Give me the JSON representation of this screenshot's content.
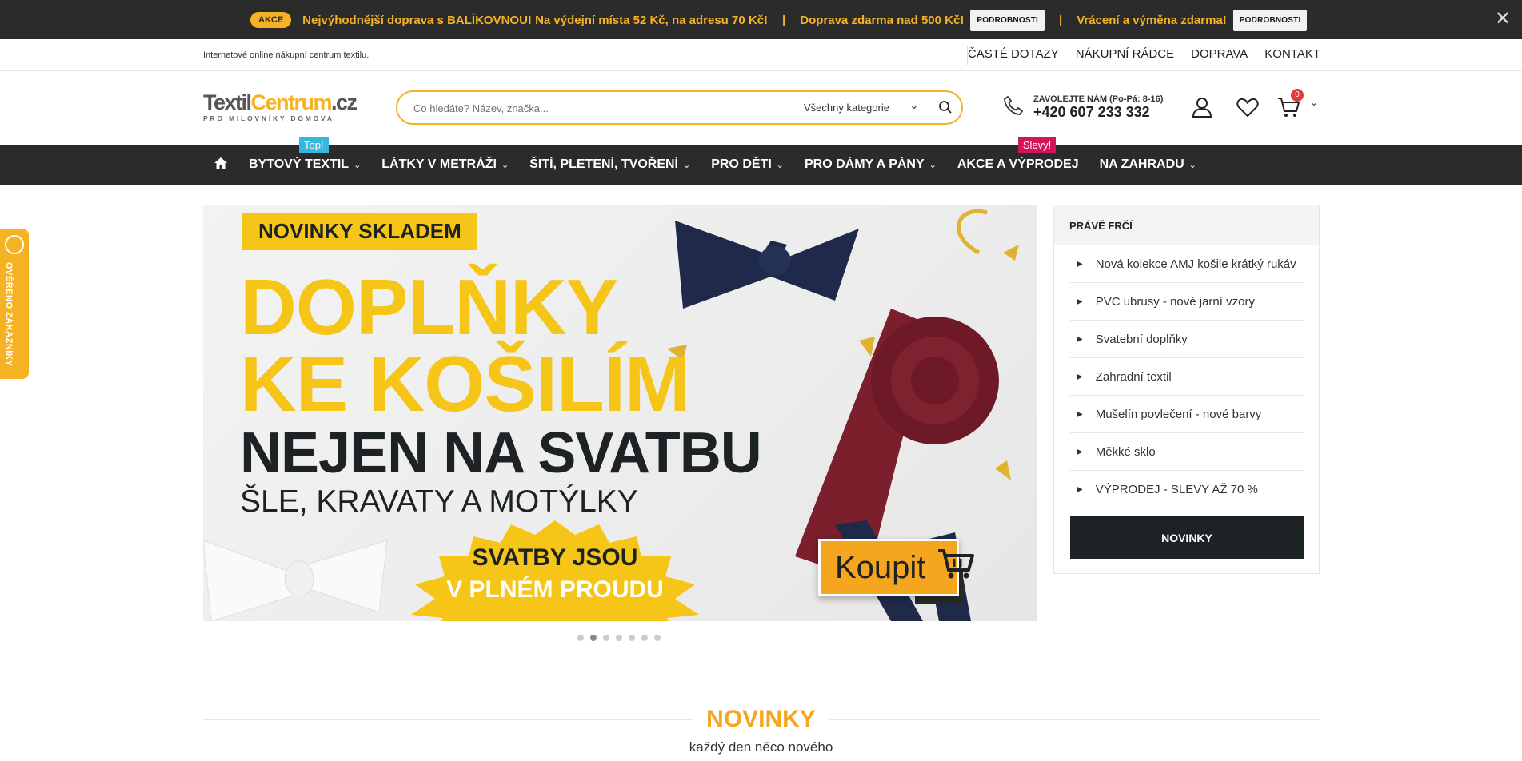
{
  "topbar": {
    "akce_badge": "AKCE",
    "promo_prefix": "Nejvýhodnější doprava s ",
    "promo_brand": "BALÍKOVNOU!",
    "promo_rest": " Na výdejní místa 52 Kč, na adresu 70 Kč!",
    "sep": "|",
    "free_shipping": "Doprava zdarma nad 500 Kč!",
    "details_label": "PODROBNOSTI",
    "returns": "Vrácení a výměna zdarma!",
    "close": "✕"
  },
  "utilbar": {
    "tagline": "Internetové online nákupní centrum textilu.",
    "links": [
      "ČASTÉ DOTAZY",
      "NÁKUPNÍ RÁDCE",
      "DOPRAVA",
      "KONTAKT"
    ]
  },
  "header": {
    "logo_textil": "Textil",
    "logo_centrum": "Centrum",
    "logo_cz": ".cz",
    "logo_sub": "PRO MILOVNÍKY DOMOVA",
    "search_placeholder": "Co hledáte? Název, značka...",
    "search_category": "Všechny kategorie",
    "phone_label": "ZAVOLEJTE NÁM (Po-Pá: 8-16)",
    "phone_number": "+420 607 233 332",
    "cart_count": "0"
  },
  "nav": {
    "items": [
      {
        "label": "BYTOVÝ TEXTIL",
        "badge": "Top!"
      },
      {
        "label": "LÁTKY V METRÁŽI"
      },
      {
        "label": "ŠITÍ, PLETENÍ, TVOŘENÍ"
      },
      {
        "label": "PRO DĚTI"
      },
      {
        "label": "PRO DÁMY A PÁNY"
      },
      {
        "label": "AKCE A VÝPRODEJ",
        "badge": "Slevy!"
      },
      {
        "label": "NA ZAHRADU"
      }
    ]
  },
  "side_tab": {
    "label": "OVĚŘENO ZÁKAZNÍKY"
  },
  "banner": {
    "tag": "NOVINKY SKLADEM",
    "line1": "DOPLŇKY",
    "line2": "KE KOŠILÍM",
    "line3": "NEJEN NA SVATBU",
    "line4": "ŠLE, KRAVATY A MOTÝLKY",
    "burst1": "SVATBY JSOU",
    "burst2": "V PLNÉM PROUDU",
    "buy": "Koupit",
    "slides": 7,
    "active_slide": 2
  },
  "panel": {
    "title": "PRÁVĚ FRČÍ",
    "items": [
      "Nová kolekce AMJ košile krátký rukáv",
      "PVC ubrusy - nové jarní vzory",
      "Svatební doplňky",
      "Zahradní textil",
      "Mušelín povlečení - nové barvy",
      "Měkké sklo",
      "VÝPRODEJ - SLEVY AŽ 70 %"
    ],
    "button": "NOVINKY"
  },
  "section": {
    "title": "NOVINKY",
    "subtitle": "každý den něco nového"
  },
  "colors": {
    "accent": "#f5b324",
    "dark": "#2b2b2b",
    "top_badge": "#35b8e0",
    "sale_badge": "#d4145a"
  }
}
